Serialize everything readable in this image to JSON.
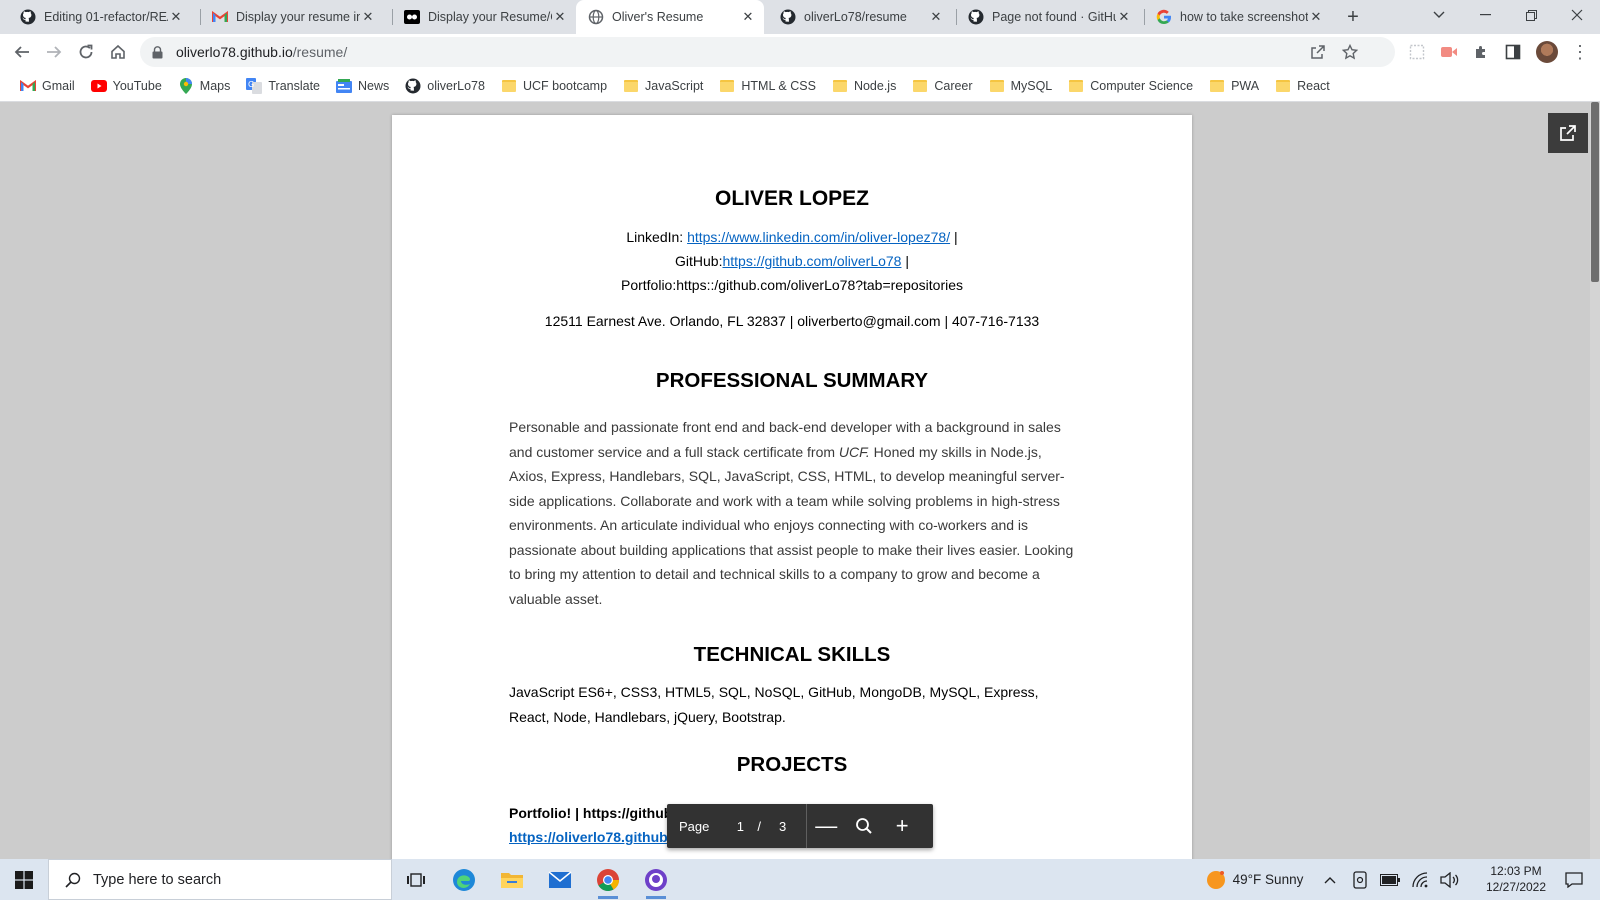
{
  "browser": {
    "tabs": [
      {
        "title": "Editing 01-refactor/REA",
        "icon": "github-icon"
      },
      {
        "title": "Display your resume in",
        "icon": "gmail-icon"
      },
      {
        "title": "Display your Resume/C",
        "icon": "recording-icon"
      },
      {
        "title": "Oliver's Resume",
        "icon": "globe-icon",
        "active": true
      },
      {
        "title": "oliverLo78/resume",
        "icon": "github-icon"
      },
      {
        "title": "Page not found · GitHu",
        "icon": "github-icon"
      },
      {
        "title": "how to take screenshot",
        "icon": "google-icon"
      }
    ],
    "new_tab_symbol": "+",
    "url_host": "oliverlo78.github.io",
    "url_path": "/resume/",
    "bookmarks": [
      {
        "label": "Gmail",
        "icon": "gmail-icon"
      },
      {
        "label": "YouTube",
        "icon": "youtube-icon"
      },
      {
        "label": "Maps",
        "icon": "maps-icon"
      },
      {
        "label": "Translate",
        "icon": "translate-icon"
      },
      {
        "label": "News",
        "icon": "news-icon"
      },
      {
        "label": "oliverLo78",
        "icon": "github-icon"
      },
      {
        "label": "UCF bootcamp",
        "icon": "folder-icon"
      },
      {
        "label": "JavaScript",
        "icon": "folder-icon"
      },
      {
        "label": "HTML & CSS",
        "icon": "folder-icon"
      },
      {
        "label": "Node.js",
        "icon": "folder-icon"
      },
      {
        "label": "Career",
        "icon": "folder-icon"
      },
      {
        "label": "MySQL",
        "icon": "folder-icon"
      },
      {
        "label": "Computer Science",
        "icon": "folder-icon"
      },
      {
        "label": "PWA",
        "icon": "folder-icon"
      },
      {
        "label": "React",
        "icon": "folder-icon"
      }
    ]
  },
  "resume": {
    "name": "OLIVER LOPEZ",
    "linkedin_label": "LinkedIn:",
    "linkedin_url": "https://www.linkedin.com/in/oliver-lopez78/",
    "github_label": "GitHub:",
    "github_url": "https://github.com/oliverLo78",
    "separator": "|",
    "portfolio_line": "Portfolio:https::/github.com/oliverLo78?tab=repositories",
    "address_line": "12511 Earnest Ave. Orlando, FL 32837 | oliverberto@gmail.com | 407-716-7133",
    "summary_title": "PROFESSIONAL SUMMARY",
    "summary_before": "Personable and passionate front end and back-end developer with a background in sales and customer service and a full stack certificate from ",
    "summary_emph": "UCF.",
    "summary_after": " Honed my skills in Node.js, Axios, Express, Handlebars, SQL, JavaScript, CSS, HTML, to develop meaningful server-side applications. Collaborate and work with a team while solving problems in high-stress environments. An articulate individual who enjoys connecting with co-workers and is passionate about building applications that assist people to make their lives easier. Looking to bring my attention to detail and technical skills to a company to grow and become a valuable asset.",
    "skills_title": "TECHNICAL SKILLS",
    "skills_text": "JavaScript ES6+, CSS3, HTML5, SQL, NoSQL, GitHub, MongoDB, MySQL, Express, React, Node, Handlebars, jQuery, Bootstrap.",
    "projects_title": "PROJECTS",
    "project_line": "Portfolio! | https://github.com/oliverLo78/01-portfolio |",
    "project_url": "https://oliverlo78.github.io/01-portfolio/"
  },
  "pdf_controls": {
    "page_label": "Page",
    "current_page": "1",
    "slash": "/",
    "total_pages": "3",
    "zoom_out": "—",
    "zoom_in": "+"
  },
  "taskbar": {
    "search_placeholder": "Type here to search",
    "weather": "49°F  Sunny",
    "time": "12:03 PM",
    "date": "12/27/2022"
  }
}
